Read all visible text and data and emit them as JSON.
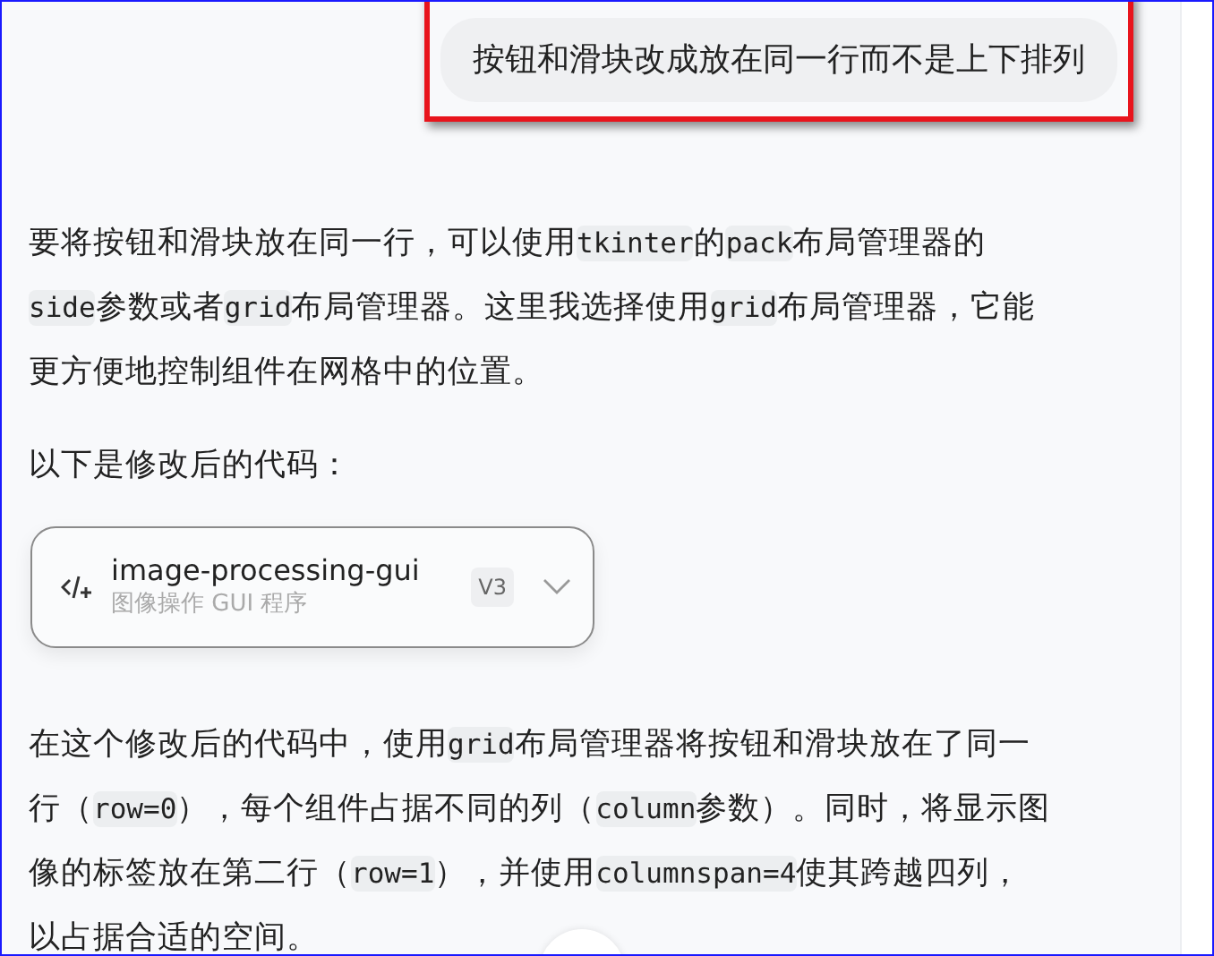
{
  "user_message": {
    "text": "按钮和滑块改成放在同一行而不是上下排列",
    "highlighted": true
  },
  "reply": [
    {
      "kind": "paragraph",
      "lines": [
        [
          {
            "text": "要将按钮和滑块放在同一行，可以使用",
            "code": false
          },
          {
            "text": "tkinter",
            "code": true
          },
          {
            "text": "的",
            "code": false
          },
          {
            "text": "pack",
            "code": true
          },
          {
            "text": "布局管理器的",
            "code": false
          }
        ],
        [
          {
            "text": "side",
            "code": true
          },
          {
            "text": "参数或者",
            "code": false
          },
          {
            "text": "grid",
            "code": true
          },
          {
            "text": "布局管理器。这里我选择使用",
            "code": false
          },
          {
            "text": "grid",
            "code": true
          },
          {
            "text": "布局管理器，它能",
            "code": false
          }
        ],
        [
          {
            "text": "更方便地控制组件在网格中的位置。",
            "code": false
          }
        ]
      ]
    },
    {
      "kind": "paragraph",
      "lines": [
        [
          {
            "text": "以下是修改后的代码：",
            "code": false
          }
        ]
      ]
    },
    {
      "kind": "artifact",
      "title": "image-processing-gui",
      "subtitle": "图像操作 GUI 程序",
      "version": "V3"
    },
    {
      "kind": "paragraph",
      "lines": [
        [
          {
            "text": "在这个修改后的代码中，使用",
            "code": false
          },
          {
            "text": "grid",
            "code": true
          },
          {
            "text": "布局管理器将按钮和滑块放在了同一",
            "code": false
          }
        ],
        [
          {
            "text": "行（",
            "code": false
          },
          {
            "text": "row=0",
            "code": true
          },
          {
            "text": "），每个组件占据不同的列（",
            "code": false
          },
          {
            "text": "column",
            "code": true
          },
          {
            "text": "参数）。同时，将显示图",
            "code": false
          }
        ],
        [
          {
            "text": "像的标签放在第二行（",
            "code": false
          },
          {
            "text": "row=1",
            "code": true
          },
          {
            "text": "），并使用",
            "code": false
          },
          {
            "text": "columnspan=4",
            "code": true
          },
          {
            "text": "使其跨越四列，",
            "code": false
          }
        ],
        [
          {
            "text": "以占据合适的空间。",
            "code": false
          }
        ]
      ]
    }
  ]
}
